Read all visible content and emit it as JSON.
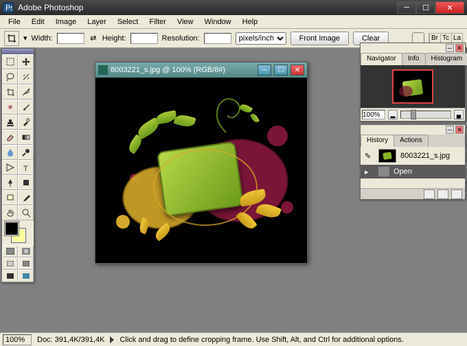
{
  "app": {
    "title": "Adobe Photoshop"
  },
  "menu": [
    "File",
    "Edit",
    "Image",
    "Layer",
    "Select",
    "Filter",
    "View",
    "Window",
    "Help"
  ],
  "options": {
    "width_label": "Width:",
    "height_label": "Height:",
    "resolution_label": "Resolution:",
    "units": "pixels/inch",
    "front_image": "Front Image",
    "clear": "Clear",
    "stubs": [
      "Br",
      "Tc",
      "La"
    ]
  },
  "document": {
    "title": "8003221_s.jpg @ 100% (RGB/8#)"
  },
  "navigator": {
    "tabs": [
      "Navigator",
      "Info",
      "Histogram"
    ],
    "zoom": "100%"
  },
  "history": {
    "tabs": [
      "History",
      "Actions"
    ],
    "doc_name": "8003221_s.jpg",
    "step": "Open"
  },
  "status": {
    "zoom": "100%",
    "doc": "Doc: 391,4K/391,4K",
    "hint": "Click and drag to define cropping frame. Use Shift, Alt, and Ctrl for additional options."
  },
  "colors": {
    "fg": "#000000",
    "bg": "#ffff99",
    "accent_green": "#8ab52a",
    "accent_dark": "#5a7a1a",
    "splat_red": "#7a1538",
    "splat_yellow": "#d4a82a"
  },
  "tools_icons": [
    "marquee",
    "move",
    "lasso",
    "wand",
    "crop",
    "slice",
    "healing",
    "brush",
    "stamp",
    "history-brush",
    "eraser",
    "gradient",
    "blur",
    "dodge",
    "path",
    "type",
    "pen",
    "shape",
    "notes",
    "eyedropper",
    "hand",
    "zoom"
  ]
}
